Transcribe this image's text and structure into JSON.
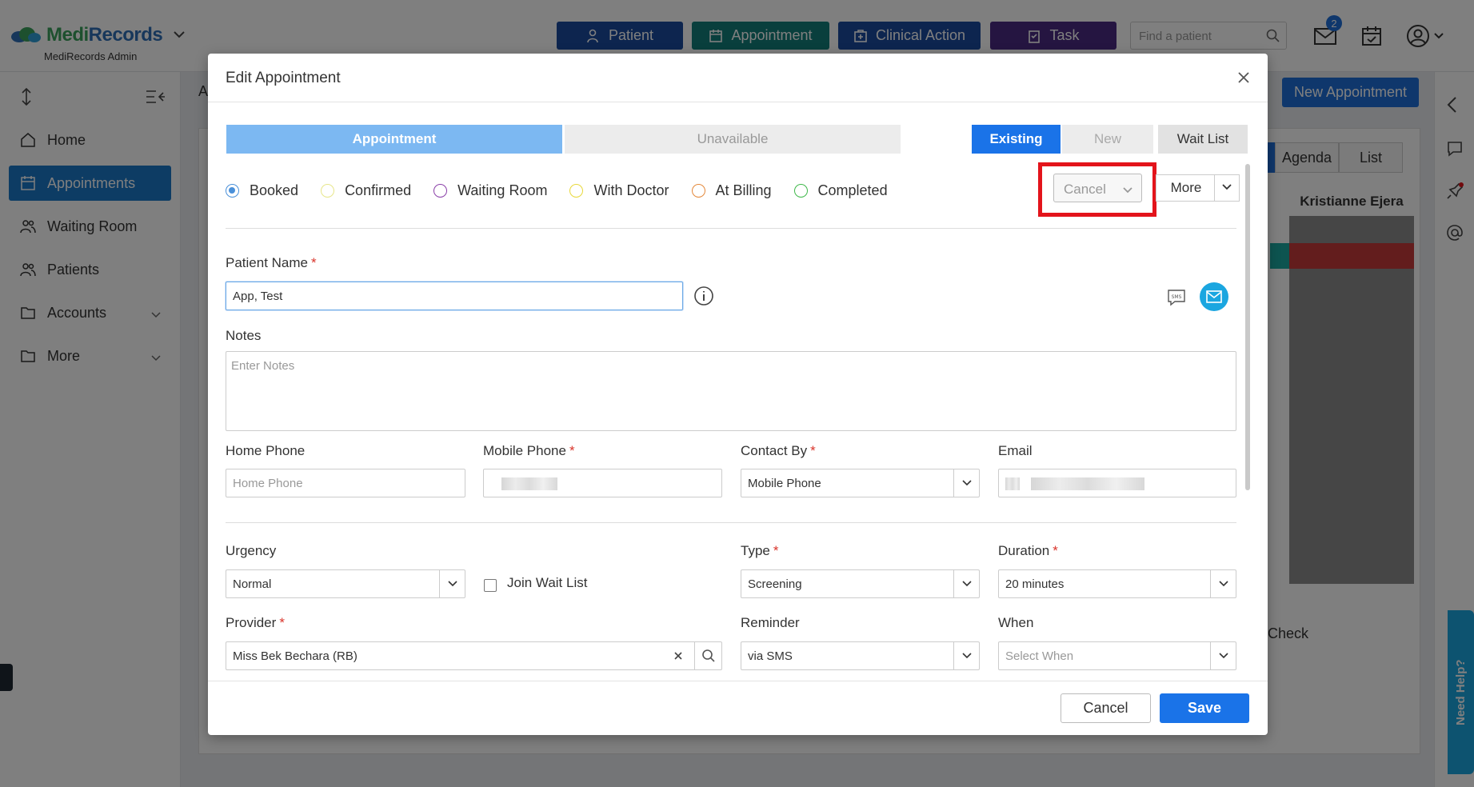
{
  "app": {
    "logo_prefix": "Medi",
    "logo_suffix": "Records",
    "subtitle": "MediRecords Admin"
  },
  "topnav": {
    "buttons": [
      {
        "label": "Patient",
        "color": "#1a4a9e"
      },
      {
        "label": "Appointment",
        "color": "#127f7a"
      },
      {
        "label": "Clinical Action",
        "color": "#1a4a9e"
      },
      {
        "label": "Task",
        "color": "#4b2a82"
      }
    ],
    "search_placeholder": "Find a patient",
    "inbox_count": "2"
  },
  "sidebar": {
    "items": [
      {
        "label": "Home",
        "icon": "home-icon"
      },
      {
        "label": "Appointments",
        "icon": "calendar-icon"
      },
      {
        "label": "Waiting Room",
        "icon": "users-icon"
      },
      {
        "label": "Patients",
        "icon": "users-icon"
      },
      {
        "label": "Accounts",
        "icon": "folder-icon"
      },
      {
        "label": "More",
        "icon": "folder-icon"
      }
    ]
  },
  "background": {
    "new_appointment": "New Appointment",
    "tabs": [
      "Agenda",
      "List"
    ],
    "column_header": "Kristianne Ejera",
    "check_text": "Check",
    "need_help": "Need Help?",
    "header_fragment": "A"
  },
  "modal": {
    "title": "Edit Appointment",
    "mode_tabs": {
      "appointment": "Appointment",
      "unavailable": "Unavailable"
    },
    "patient_tabs": {
      "existing": "Existing",
      "new": "New",
      "wait_list": "Wait List"
    },
    "statuses": [
      {
        "label": "Booked",
        "color": "#4a90d9",
        "selected": true
      },
      {
        "label": "Confirmed",
        "color": "#e7e68a",
        "selected": false
      },
      {
        "label": "Waiting Room",
        "color": "#8a3fa8",
        "selected": false
      },
      {
        "label": "With Doctor",
        "color": "#e8d83a",
        "selected": false
      },
      {
        "label": "At Billing",
        "color": "#e4883a",
        "selected": false
      },
      {
        "label": "Completed",
        "color": "#3fb84a",
        "selected": false
      }
    ],
    "cancel_select": "Cancel",
    "more_label": "More",
    "patient_name": {
      "label": "Patient Name",
      "value": "App, Test",
      "required": "*"
    },
    "notes": {
      "label": "Notes",
      "placeholder": "Enter Notes"
    },
    "home_phone": {
      "label": "Home Phone",
      "placeholder": "Home Phone"
    },
    "mobile_phone": {
      "label": "Mobile Phone",
      "required": "*"
    },
    "contact_by": {
      "label": "Contact By",
      "value": "Mobile Phone",
      "required": "*"
    },
    "email": {
      "label": "Email"
    },
    "urgency": {
      "label": "Urgency",
      "value": "Normal"
    },
    "join_wait_list": "Join Wait List",
    "type": {
      "label": "Type",
      "value": "Screening",
      "required": "*"
    },
    "duration": {
      "label": "Duration",
      "value": "20 minutes",
      "required": "*"
    },
    "provider": {
      "label": "Provider",
      "value": "Miss Bek Bechara (RB)",
      "required": "*"
    },
    "reminder": {
      "label": "Reminder",
      "value": "via SMS"
    },
    "when": {
      "label": "When",
      "placeholder": "Select When"
    },
    "footer": {
      "cancel": "Cancel",
      "save": "Save"
    }
  }
}
